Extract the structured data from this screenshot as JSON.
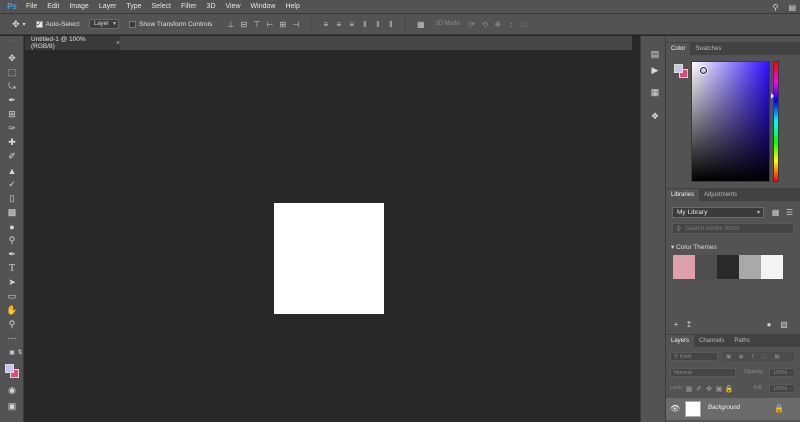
{
  "app": {
    "logo": "Ps"
  },
  "menu": [
    "File",
    "Edit",
    "Image",
    "Layer",
    "Type",
    "Select",
    "Filter",
    "3D",
    "View",
    "Window",
    "Help"
  ],
  "options": {
    "auto_select_label": "Auto-Select:",
    "auto_select_target": "Layer",
    "transform_label": "Show Transform Controls",
    "mode_3d_label": "3D Mode:"
  },
  "document": {
    "tab_title": "Untitled-1 @ 100% (RGB/8)",
    "canvas_color": "#ffffff"
  },
  "colors": {
    "foreground": "#c7c5f0",
    "background": "#e6487a"
  },
  "panels": {
    "color_tabs": [
      "Color",
      "Swatches"
    ],
    "libraries_tabs": [
      "Libraries",
      "Adjustments"
    ],
    "library_name": "My Library",
    "search_placeholder": "Search Adobe Stock",
    "color_themes_label": "Color Themes",
    "theme_swatches": [
      "#dda1a9",
      "#4e4e4e",
      "#2a2a2a",
      "#a9a9a9",
      "#f3f3f3"
    ],
    "layers_tabs": [
      "Layers",
      "Channels",
      "Paths"
    ],
    "kind_label": "Kind",
    "blend_mode": "Normal",
    "opacity_label": "Opacity:",
    "opacity_value": "100%",
    "lock_label": "Lock:",
    "fill_label": "Fill:",
    "fill_value": "100%",
    "layer_name": "Background"
  }
}
